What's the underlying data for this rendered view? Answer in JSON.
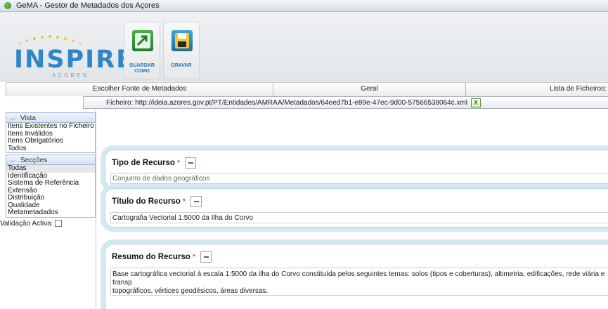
{
  "window": {
    "title": "GeMA - Gestor de Metadados dos Açores"
  },
  "logo": {
    "word": "INSPIRE",
    "sub": "AÇORES"
  },
  "toolbar": {
    "save_as_label": "GUARDAR COMO",
    "save_label": "GRAVAR"
  },
  "tabs": [
    {
      "label": "Escolher Fonte de Metadados"
    },
    {
      "label": "Geral"
    },
    {
      "label": "Lista de Ficheiros:"
    }
  ],
  "file": {
    "label": "Ficheiro: http://ideia.azores.gov.pt/PT/Entidades/AMRAA/Metadados/64eed7b1-e89e-47ec-9d00-57566538064c.xml",
    "close_label": "X"
  },
  "sidebar": {
    "view": {
      "title": "Vista",
      "items": [
        "Itens Existentes no Ficheiro",
        "Itens Inválidos",
        "Itens Obrigatórios",
        "Todos"
      ]
    },
    "sections": {
      "title": "Secções",
      "items": [
        "Todas",
        "Identificação",
        "Sistema de Referência",
        "Extensão",
        "Distribuição",
        "Qualidade",
        "Metametadados"
      ]
    },
    "validation_label": "Validação Activa:"
  },
  "fields": {
    "resource_type": {
      "label": "Tipo de Recurso",
      "required_mark": "*",
      "value": "Conjunto de dados geográficos"
    },
    "resource_title": {
      "label": "Título do Recurso",
      "required_mark": "*",
      "value": "Cartografia Vectorial 1:5000 da Ilha do Corvo"
    },
    "resource_abstract": {
      "label": "Resumo do Recurso",
      "required_mark": "*",
      "value": "Base cartográfica vectorial à escala 1:5000 da ilha do Corvo constituída pelos seguintes temas: solos (tipos e coberturas), altimetria, edificações, rede viária e transp\ntopográficos, vértices geodésicos, áreas diversas."
    }
  },
  "colors": {
    "accent_blue": "#2e86c8",
    "required_red": "#d92020",
    "card_glow": "#d3e8f3"
  }
}
